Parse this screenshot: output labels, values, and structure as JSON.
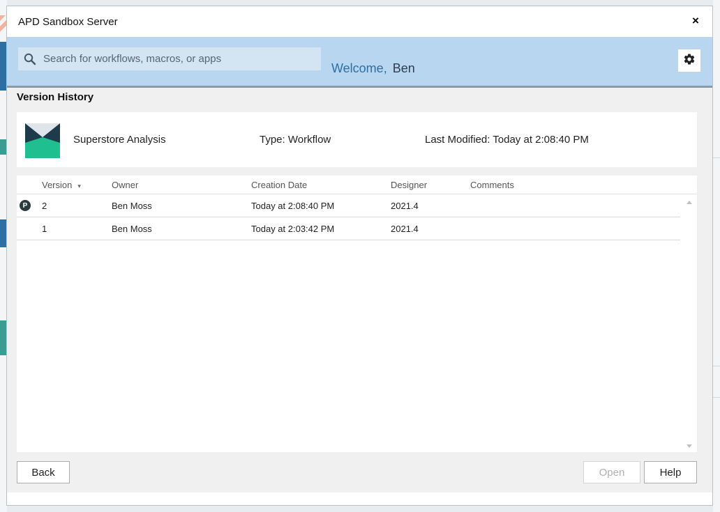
{
  "window": {
    "title": "APD Sandbox Server",
    "close_label": "×"
  },
  "header": {
    "search_placeholder": "Search for workflows, macros, or apps",
    "welcome_label": "Welcome,",
    "user_name": "Ben",
    "settings_icon": "gear-icon"
  },
  "section": {
    "title": "Version History"
  },
  "item": {
    "name": "Superstore Analysis",
    "type": "Type: Workflow",
    "last_modified": "Last Modified: Today at 2:08:40 PM"
  },
  "table": {
    "columns": [
      "Version",
      "Owner",
      "Creation Date",
      "Designer",
      "Comments"
    ],
    "sort_indicator": "▾",
    "rows": [
      {
        "published_badge": "P",
        "version": "2",
        "owner": "Ben Moss",
        "creation_date": "Today at 2:08:40 PM",
        "designer": "2021.4",
        "comments": ""
      },
      {
        "published_badge": "",
        "version": "1",
        "owner": "Ben Moss",
        "creation_date": "Today at 2:03:42 PM",
        "designer": "2021.4",
        "comments": ""
      }
    ]
  },
  "buttons": {
    "back": "Back",
    "open": "Open",
    "help": "Help"
  },
  "colors": {
    "header_bg": "#b9d6f0",
    "accent": "#2a6fa8",
    "logo_dark": "#1f3a4a",
    "logo_green": "#1fbf8f"
  }
}
